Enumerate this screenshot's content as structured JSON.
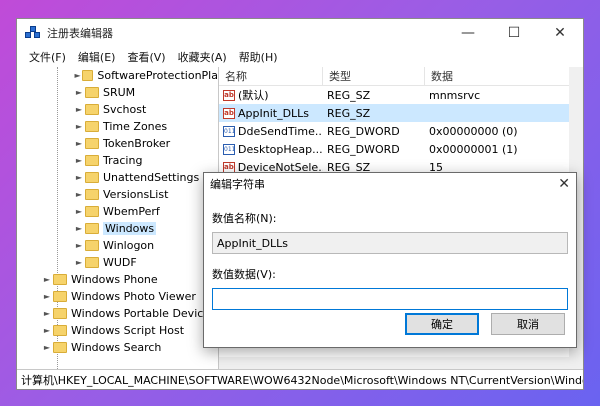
{
  "window": {
    "title": "注册表编辑器",
    "minimize": "—",
    "maximize": "☐",
    "close": "✕"
  },
  "menu": [
    "文件(F)",
    "编辑(E)",
    "查看(V)",
    "收藏夹(A)",
    "帮助(H)"
  ],
  "tree": {
    "sub_items": [
      "SoftwareProtectionPla",
      "SRUM",
      "Svchost",
      "Time Zones",
      "TokenBroker",
      "Tracing",
      "UnattendSettings",
      "VersionsList",
      "WbemPerf",
      "Windows",
      "Winlogon",
      "WUDF"
    ],
    "selected": "Windows",
    "top_items": [
      "Windows Phone",
      "Windows Photo Viewer",
      "Windows Portable Devices",
      "Windows Script Host",
      "Windows Search"
    ]
  },
  "list": {
    "headers": [
      "名称",
      "类型",
      "数据"
    ],
    "rows": [
      {
        "icon": "ab",
        "name": "(默认)",
        "type": "REG_SZ",
        "data": "mnmsrvc",
        "selected": false
      },
      {
        "icon": "ab",
        "name": "AppInit_DLLs",
        "type": "REG_SZ",
        "data": "",
        "selected": true
      },
      {
        "icon": "bin",
        "name": "DdeSendTime...",
        "type": "REG_DWORD",
        "data": "0x00000000 (0)",
        "selected": false
      },
      {
        "icon": "bin",
        "name": "DesktopHeap...",
        "type": "REG_DWORD",
        "data": "0x00000001 (1)",
        "selected": false
      },
      {
        "icon": "ab",
        "name": "DeviceNotSele...",
        "type": "REG_SZ",
        "data": "15",
        "selected": false
      }
    ]
  },
  "statusbar": "计算机\\HKEY_LOCAL_MACHINE\\SOFTWARE\\WOW6432Node\\Microsoft\\Windows NT\\CurrentVersion\\Windows",
  "dialog": {
    "title": "编辑字符串",
    "close": "✕",
    "name_label": "数值名称(N):",
    "name_value": "AppInit_DLLs",
    "data_label": "数值数据(V):",
    "data_value": "",
    "ok": "确定",
    "cancel": "取消"
  }
}
